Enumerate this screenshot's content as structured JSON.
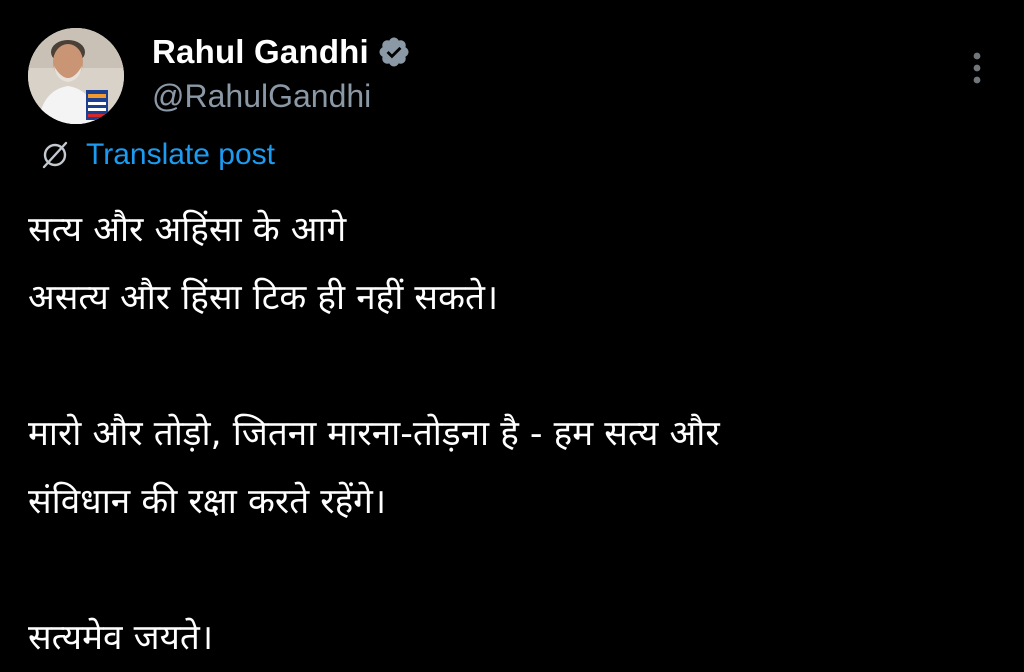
{
  "post": {
    "author": {
      "display_name": "Rahul Gandhi",
      "handle": "@RahulGandhi",
      "verified_icon": "verified-badge-icon",
      "avatar_icon": "profile-photo"
    },
    "menu_icon": "more-vertical-icon",
    "translate": {
      "label": "Translate post",
      "icon": "translate-globe-icon",
      "color": "#1d9bf0"
    },
    "paragraphs": [
      {
        "lines": [
          "सत्य और अहिंसा के आगे",
          "असत्य और हिंसा टिक ही नहीं सकते।"
        ]
      },
      {
        "lines": [
          "मारो और तोड़ो, जितना मारना-तोड़ना है - हम सत्य और",
          "संविधान की रक्षा करते रहेंगे।"
        ]
      },
      {
        "lines": [
          "सत्यमेव जयते।"
        ]
      }
    ]
  },
  "theme": {
    "background": "#000000",
    "text": "#ffffff",
    "secondary_text": "#8b98a5",
    "accent": "#1d9bf0"
  }
}
